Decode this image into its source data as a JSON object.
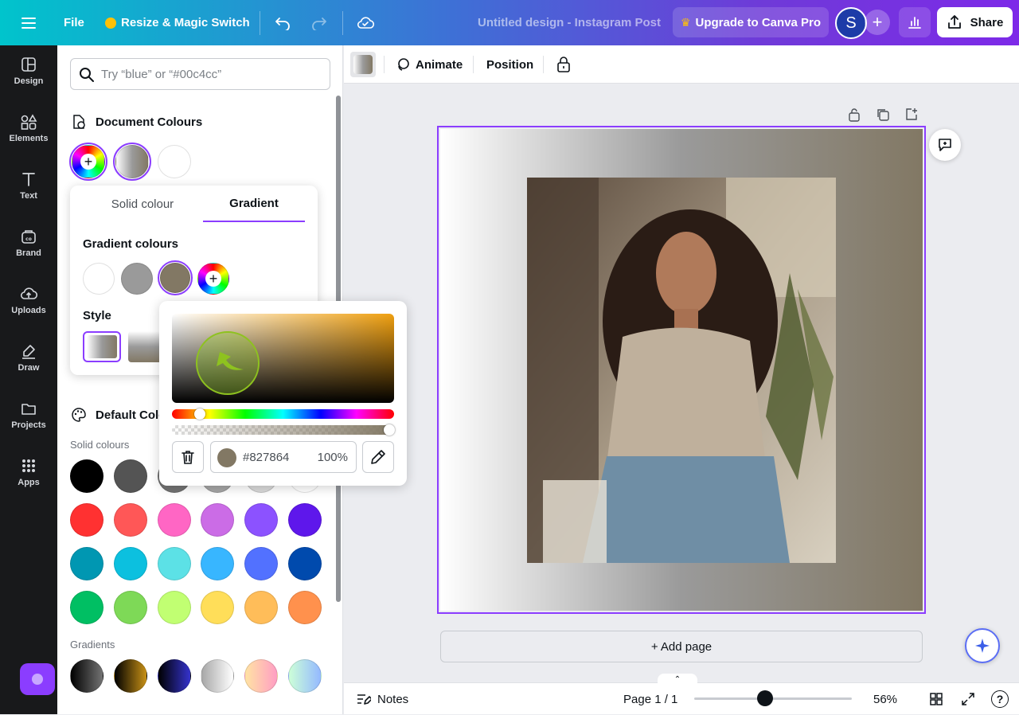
{
  "topbar": {
    "menu_icon": "menu-icon",
    "file_label": "File",
    "resize_label": "Resize & Magic Switch",
    "crown_icon": "crown-icon",
    "undo_icon": "undo-icon",
    "redo_icon": "redo-icon",
    "cloud_icon": "cloud-saved-icon",
    "doc_title": "Untitled design - Instagram Post",
    "upgrade_label": "Upgrade to Canva Pro",
    "avatar_initial": "S",
    "add_member": "+",
    "share_label": "Share"
  },
  "sidebar": {
    "items": [
      {
        "label": "Design",
        "icon": "design-icon"
      },
      {
        "label": "Elements",
        "icon": "elements-icon"
      },
      {
        "label": "Text",
        "icon": "text-icon"
      },
      {
        "label": "Brand",
        "icon": "brand-icon"
      },
      {
        "label": "Uploads",
        "icon": "uploads-icon"
      },
      {
        "label": "Draw",
        "icon": "draw-icon"
      },
      {
        "label": "Projects",
        "icon": "projects-icon"
      },
      {
        "label": "Apps",
        "icon": "apps-icon"
      }
    ]
  },
  "panel": {
    "search_placeholder": "Try “blue” or “#00c4cc”",
    "document_colours_title": "Document Colours",
    "document_colours": [
      "add",
      "gradient-grey",
      "#ffffff"
    ],
    "default_colours_title": "Default Colo",
    "solid_colours_label": "Solid colours",
    "solid_colours": [
      [
        "#000000",
        "#545454",
        "#737373",
        "#a6a6a6",
        "#d9d9d9",
        "#ffffff"
      ],
      [
        "#ff3131",
        "#ff5757",
        "#ff66c4",
        "#cb6ce6",
        "#8c52ff",
        "#5e17eb"
      ],
      [
        "#0097b2",
        "#0cc0df",
        "#5ce1e6",
        "#38b6ff",
        "#5271ff",
        "#004aad"
      ],
      [
        "#00bf63",
        "#7ed957",
        "#c1ff72",
        "#ffde59",
        "#ffbd59",
        "#ff914d"
      ]
    ],
    "gradients_label": "Gradients",
    "gradients": [
      [
        "#000000",
        "#737373"
      ],
      [
        "#000000",
        "#c89116"
      ],
      [
        "#000000",
        "#3533cd"
      ],
      [
        "#a6a6a6",
        "#ffffff"
      ],
      [
        "#ffe3a3",
        "#ff9ec4"
      ],
      [
        "#cdffd8",
        "#94b9ff"
      ]
    ]
  },
  "gradient_popup": {
    "tab_solid": "Solid colour",
    "tab_gradient": "Gradient",
    "gradient_colours_title": "Gradient colours",
    "gradient_colours": [
      "#ffffff",
      "#9a9a9a",
      "#827864"
    ],
    "style_title": "Style"
  },
  "color_picker": {
    "hex_value": "#827864",
    "opacity": "100%",
    "trash_icon": "trash-icon",
    "eyedropper_icon": "eyedropper-icon"
  },
  "toolbar2": {
    "animate_label": "Animate",
    "position_label": "Position",
    "lock_icon": "lock-icon"
  },
  "canvas": {
    "add_page_label": "+ Add page"
  },
  "footer": {
    "notes_label": "Notes",
    "page_indicator": "Page 1 / 1",
    "zoom_level": "56%",
    "zoom_fraction": 0.45,
    "help_label": "?"
  }
}
